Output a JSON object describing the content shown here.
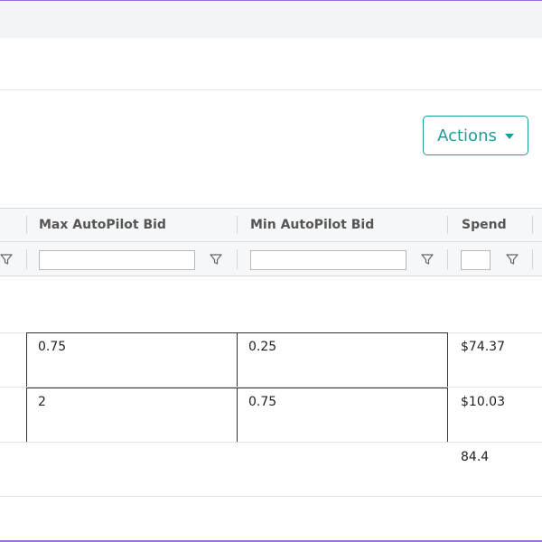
{
  "actions_button": {
    "label": "Actions"
  },
  "grid": {
    "columns": [
      {
        "label": "Max AutoPilot Bid"
      },
      {
        "label": "Min AutoPilot Bid"
      },
      {
        "label": "Spend"
      }
    ],
    "rows": [
      {
        "max_bid": "0.75",
        "min_bid": "0.25",
        "spend": "$74.37"
      },
      {
        "max_bid": "2",
        "min_bid": "0.75",
        "spend": "$10.03"
      }
    ],
    "total": {
      "spend": "84.4"
    }
  },
  "icons": {
    "filter": "filter-icon",
    "actions_caret": "chevron-down-icon"
  },
  "colors": {
    "accent": "#1e9e96",
    "topbar": "#f3f4f8",
    "header_bg": "#f6f7f8"
  }
}
